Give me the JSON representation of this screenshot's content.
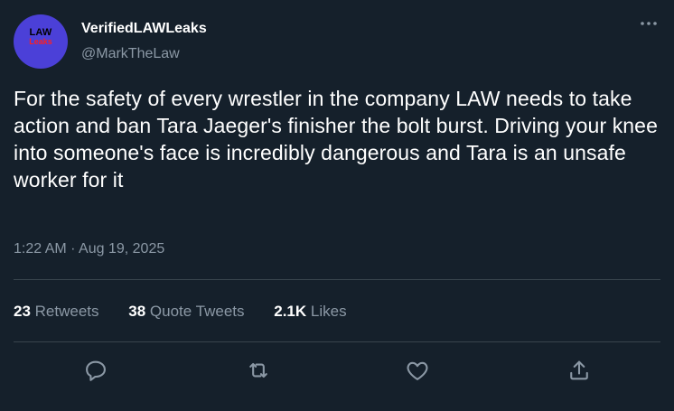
{
  "author": {
    "display_name": "VerifiedLAWLeaks",
    "handle": "@MarkTheLaw",
    "avatar_text_top": "LAW",
    "avatar_text_bottom": "Leaks",
    "avatar_bg": "#4b40d8"
  },
  "tweet": {
    "text": "For the safety of every wrestler in the company LAW needs to take action and ban Tara Jaeger's finisher the bolt burst. Driving your knee into someone's face is incredibly dangerous and Tara is an unsafe worker for it",
    "time": "1:22 AM",
    "separator": "·",
    "date": "Aug 19, 2025"
  },
  "stats": {
    "retweets_count": "23",
    "retweets_label": "Retweets",
    "quote_count": "38",
    "quote_label": "Quote Tweets",
    "likes_count": "2.1K",
    "likes_label": "Likes"
  },
  "actions": {
    "reply_icon": "reply-icon",
    "retweet_icon": "retweet-icon",
    "like_icon": "heart-icon",
    "share_icon": "share-icon"
  },
  "colors": {
    "background": "#15202b",
    "text": "#ffffff",
    "secondary": "#8b98a5",
    "divider": "#38444d"
  }
}
